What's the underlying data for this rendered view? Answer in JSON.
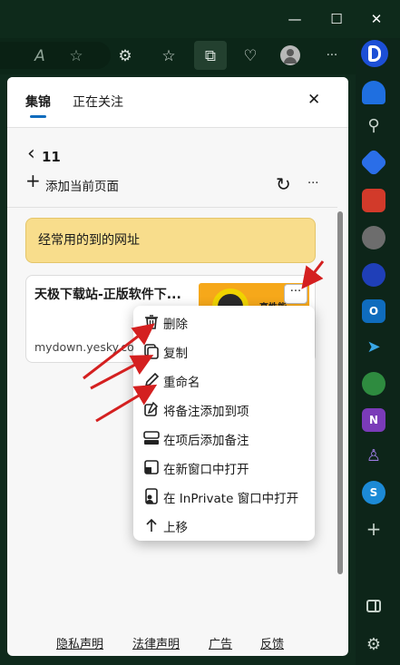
{
  "window": {
    "minimize_glyph": "—",
    "maximize_glyph": "☐",
    "close_glyph": "✕"
  },
  "toolbar": {
    "icons": [
      "read-aloud-icon",
      "favorite-star-icon",
      "extensions-icon",
      "favorites-icon",
      "collections-icon",
      "browser-essentials-icon",
      "profile-avatar-icon",
      "more-icon"
    ],
    "read_aloud_glyph": "A",
    "more_glyph": "···"
  },
  "panel": {
    "tabs": [
      {
        "label": "集锦",
        "active": true
      },
      {
        "label": "正在关注",
        "active": false
      }
    ],
    "close_glyph": "✕",
    "back_glyph": "‹",
    "collection_count": "11",
    "add_page_label": "添加当前页面",
    "add_glyph": "+",
    "refresh_glyph": "↻",
    "more_glyph": "···",
    "note_text": "经常用的到的网址",
    "card": {
      "title": "天极下载站-正版软件下...",
      "url": "mydown.yesky.com",
      "thumb_text": "高性能..."
    }
  },
  "context_menu": {
    "items": [
      {
        "label": "删除",
        "icon": "trash-icon"
      },
      {
        "label": "复制",
        "icon": "copy-icon"
      },
      {
        "label": "重命名",
        "icon": "pencil-icon"
      },
      {
        "label": "将备注添加到项",
        "icon": "note-add-icon"
      },
      {
        "label": "在项后添加备注",
        "icon": "note-below-icon"
      },
      {
        "label": "在新窗口中打开",
        "icon": "new-window-icon"
      },
      {
        "label": "在 InPrivate 窗口中打开",
        "icon": "inprivate-icon"
      },
      {
        "label": "上移",
        "icon": "arrow-up-icon"
      }
    ]
  },
  "footer": {
    "links": [
      "隐私声明",
      "法律声明",
      "广告",
      "反馈"
    ]
  },
  "sidebar": {
    "plus_glyph": "+",
    "onenote_letter": "N",
    "outlook_letter": "O",
    "skype_letter": "S"
  },
  "colors": {
    "accent": "#0f6cbd",
    "annotation_arrow": "#d42020",
    "note_bg": "#f8dd8c",
    "frame_bg": "#0f2a1c"
  }
}
